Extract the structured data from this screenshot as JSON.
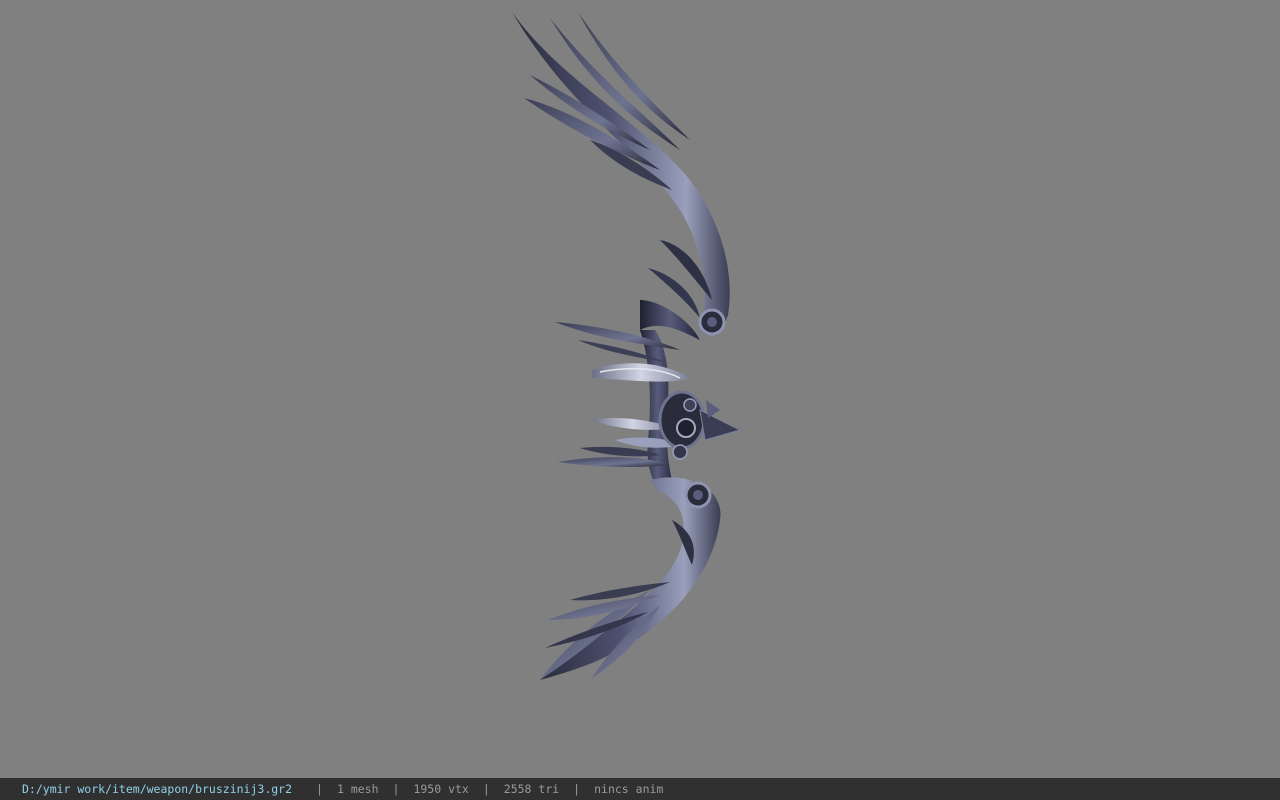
{
  "viewer": {
    "background_color": "#808080",
    "model_description_icon": "bow-weapon-model",
    "model_colors": {
      "dark": "#2a2c3c",
      "mid": "#4e5270",
      "light": "#9aa0bc",
      "highlight": "#c8ccde"
    }
  },
  "status_bar": {
    "file_path": "D:/ymir work/item/weapon/bruszinij3.gr2",
    "separator": "|",
    "mesh_count": "1 mesh",
    "vertex_count": "1950 vtx",
    "triangle_count": "2558 tri",
    "animation": "nincs anim",
    "path_color": "#8fd0e8",
    "background_color": "#303030"
  }
}
